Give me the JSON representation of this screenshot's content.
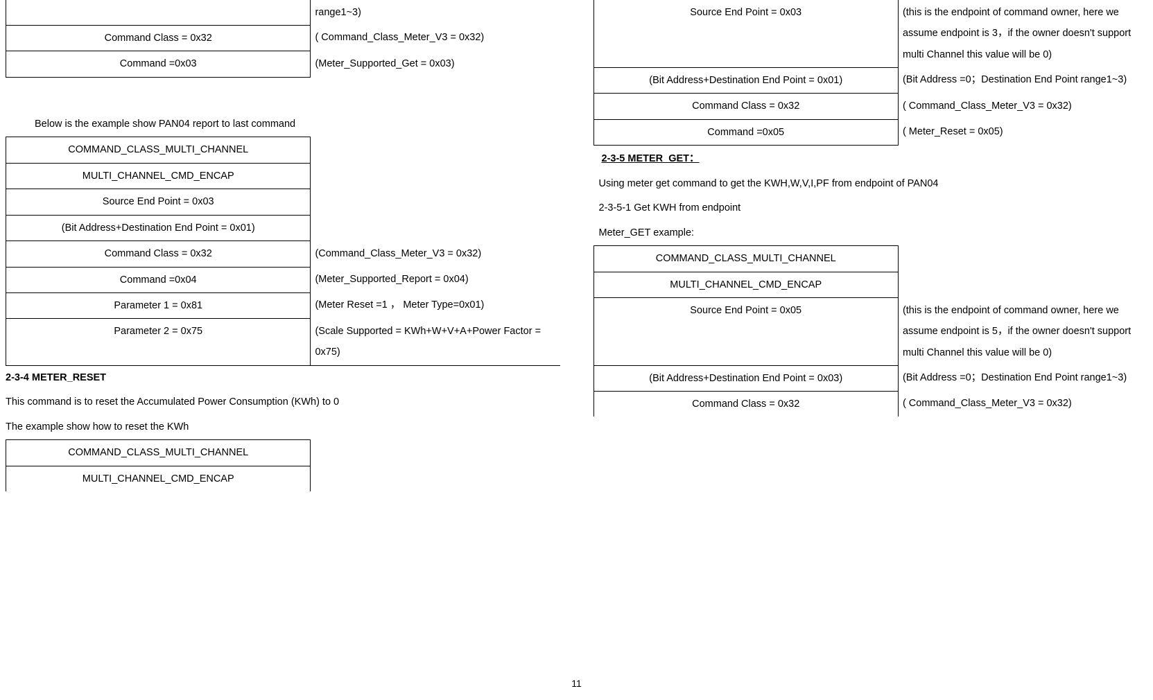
{
  "left": {
    "table1": {
      "r1_right": "range1~3)",
      "r2_left": "Command Class = 0x32",
      "r2_right": "( Command_Class_Meter_V3 = 0x32)",
      "r3_left": "Command =0x03",
      "r3_right": "(Meter_Supported_Get = 0x03)"
    },
    "below_text": "Below is the example show PAN04 report to last command",
    "table2": {
      "r1_left": "COMMAND_CLASS_MULTI_CHANNEL",
      "r2_left": "MULTI_CHANNEL_CMD_ENCAP",
      "r3_left": "Source End Point = 0x03",
      "r4_left": "(Bit Address+Destination End Point = 0x01)",
      "r5_left": "Command Class = 0x32",
      "r5_right": "(Command_Class_Meter_V3 = 0x32)",
      "r6_left": "Command =0x04",
      "r6_right": "(Meter_Supported_Report = 0x04)",
      "r7_left": "Parameter 1 = 0x81",
      "r7_right": "(Meter Reset =1 ， Meter Type=0x01)",
      "r8_left": "Parameter 2 = 0x75",
      "r8_right": "(Scale Supported = KWh+W+V+A+Power Factor = 0x75)"
    },
    "meter_reset_title": "2-3-4 METER_RESET",
    "meter_reset_desc": "This command is to reset the Accumulated Power Consumption (KWh) to 0",
    "meter_reset_ex": "The example show how to reset the KWh",
    "table3": {
      "r1_left": "COMMAND_CLASS_MULTI_CHANNEL",
      "r2_left": "MULTI_CHANNEL_CMD_ENCAP"
    }
  },
  "right": {
    "table4": {
      "r1_left": "Source End Point = 0x03",
      "r1_right": "(this is the endpoint of command owner, here we assume endpoint is 3，if the owner doesn't support multi Channel this value will be 0)",
      "r2_left": "(Bit Address+Destination End Point = 0x01)",
      "r2_right": "(Bit Address =0；Destination End Point range1~3)",
      "r3_left": "Command Class = 0x32",
      "r3_right": "( Command_Class_Meter_V3 = 0x32)",
      "r4_left": "Command =0x05",
      "r4_right": "( Meter_Reset = 0x05)"
    },
    "meter_get_title": "2-3-5 METER_GET：",
    "meter_get_desc": "Using meter get command to get the KWH,W,V,I,PF from endpoint of PAN04",
    "meter_get_sub": "2-3-5-1 Get KWH from endpoint",
    "meter_get_ex": "Meter_GET example:",
    "table5": {
      "r1_left": "COMMAND_CLASS_MULTI_CHANNEL",
      "r2_left": "MULTI_CHANNEL_CMD_ENCAP",
      "r3_left": "Source End Point = 0x05",
      "r3_right": "(this is the endpoint of command owner, here we assume endpoint is 5，if the owner doesn't support multi Channel this value will be 0)",
      "r4_left": "(Bit Address+Destination End Point = 0x03)",
      "r4_right": "(Bit Address =0；Destination End Point range1~3)",
      "r5_left": "Command Class = 0x32",
      "r5_right": "( Command_Class_Meter_V3 = 0x32)"
    }
  },
  "page_number": "11"
}
